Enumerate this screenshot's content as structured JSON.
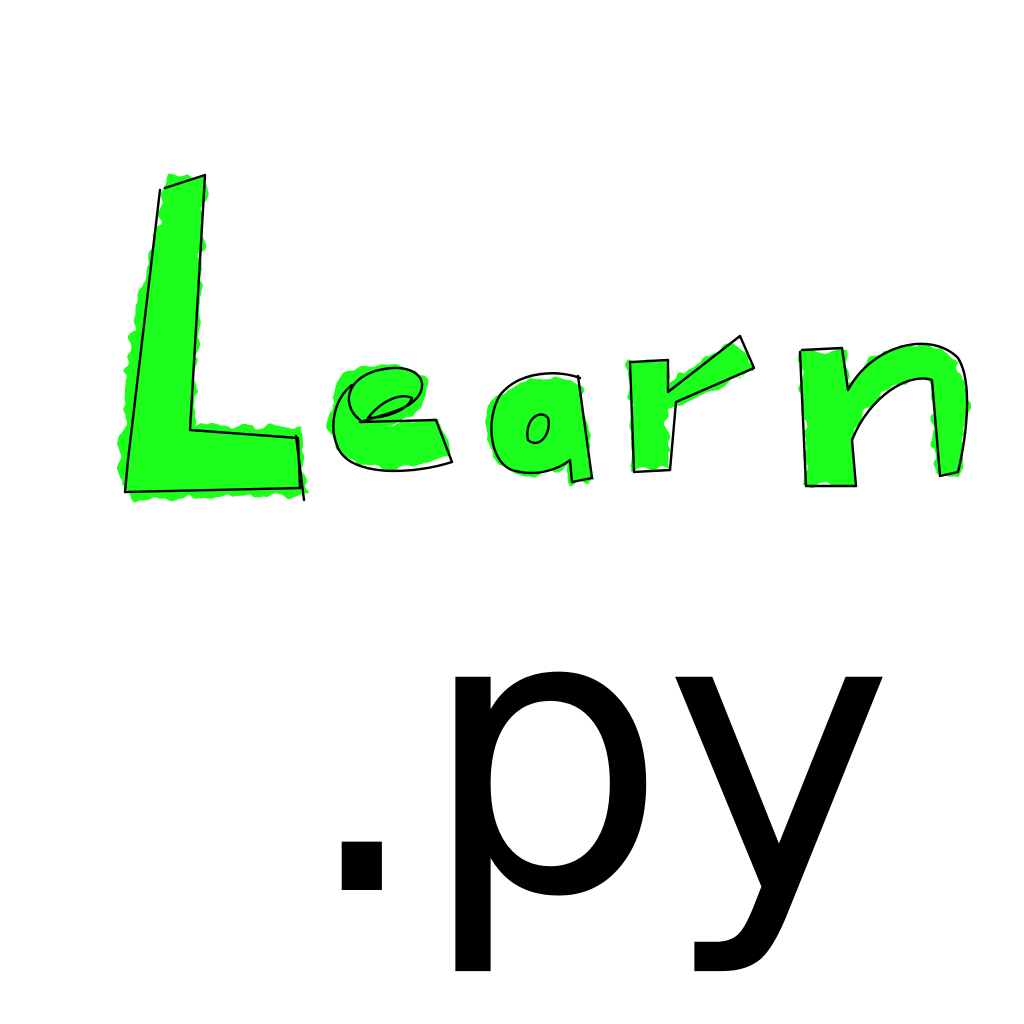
{
  "logo": {
    "wordmark": "Learn",
    "extension": ".py"
  },
  "colors": {
    "background": "#ffffff",
    "highlight": "#1aff1a",
    "ink": "#000000"
  }
}
